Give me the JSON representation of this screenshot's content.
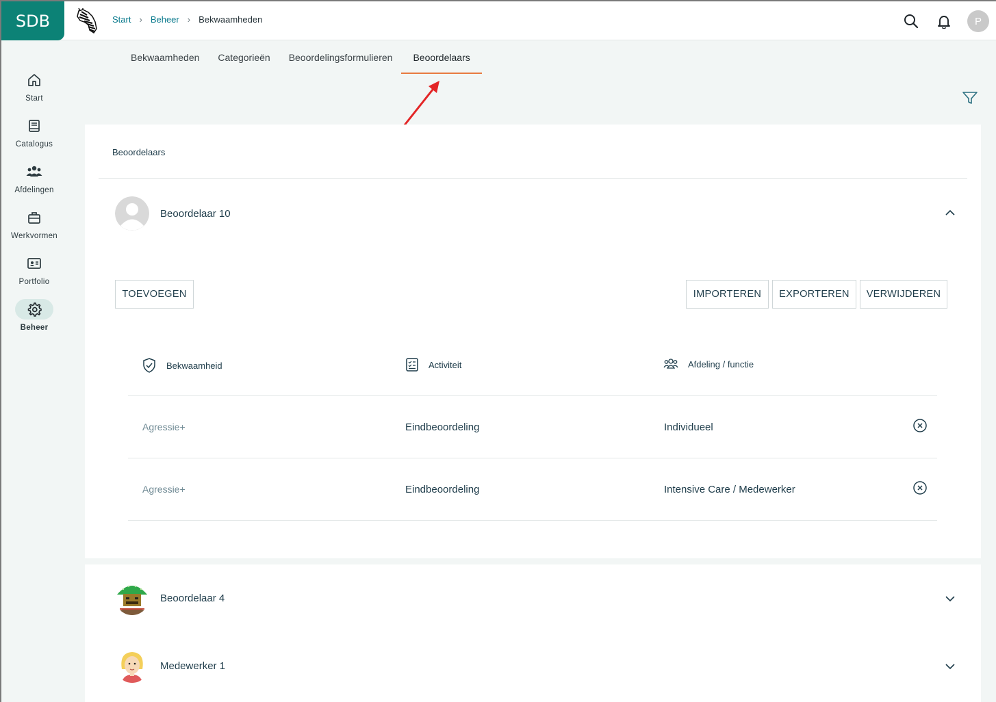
{
  "topbar": {
    "logo_text": "SDB",
    "breadcrumb": [
      "Start",
      "Beheer",
      "Bekwaamheden"
    ],
    "avatar_initial": "P",
    "brand_color": "#0c8276"
  },
  "sidebar": {
    "items": [
      {
        "label": "Start",
        "icon": "home-icon"
      },
      {
        "label": "Catalogus",
        "icon": "book-icon"
      },
      {
        "label": "Afdelingen",
        "icon": "people-icon"
      },
      {
        "label": "Werkvormen",
        "icon": "briefcase-icon"
      },
      {
        "label": "Portfolio",
        "icon": "id-card-icon"
      },
      {
        "label": "Beheer",
        "icon": "gear-icon",
        "active": true
      }
    ]
  },
  "tabs": {
    "items": [
      "Bekwaamheden",
      "Categorieën",
      "Beoordelingsformulieren",
      "Beoordelaars"
    ],
    "active": "Beoordelaars",
    "accent": "#e8793f"
  },
  "main": {
    "title": "Beoordelaars",
    "assessors": [
      {
        "name": "Beoordelaar 10",
        "expanded": true
      },
      {
        "name": "Beoordelaar 4",
        "expanded": false
      },
      {
        "name": "Medewerker 1",
        "expanded": false
      }
    ],
    "buttons": {
      "add": "TOEVOEGEN",
      "import": "IMPORTEREN",
      "export": "EXPORTEREN",
      "delete": "VERWIJDEREN"
    },
    "table": {
      "headers": {
        "competence": "Bekwaamheid",
        "activity": "Activiteit",
        "department": "Afdeling / functie"
      },
      "rows": [
        {
          "competence": "Agressie+",
          "activity": "Eindbeoordeling",
          "department": "Individueel"
        },
        {
          "competence": "Agressie+",
          "activity": "Eindbeoordeling",
          "department": "Intensive Care / Medewerker"
        }
      ]
    }
  }
}
